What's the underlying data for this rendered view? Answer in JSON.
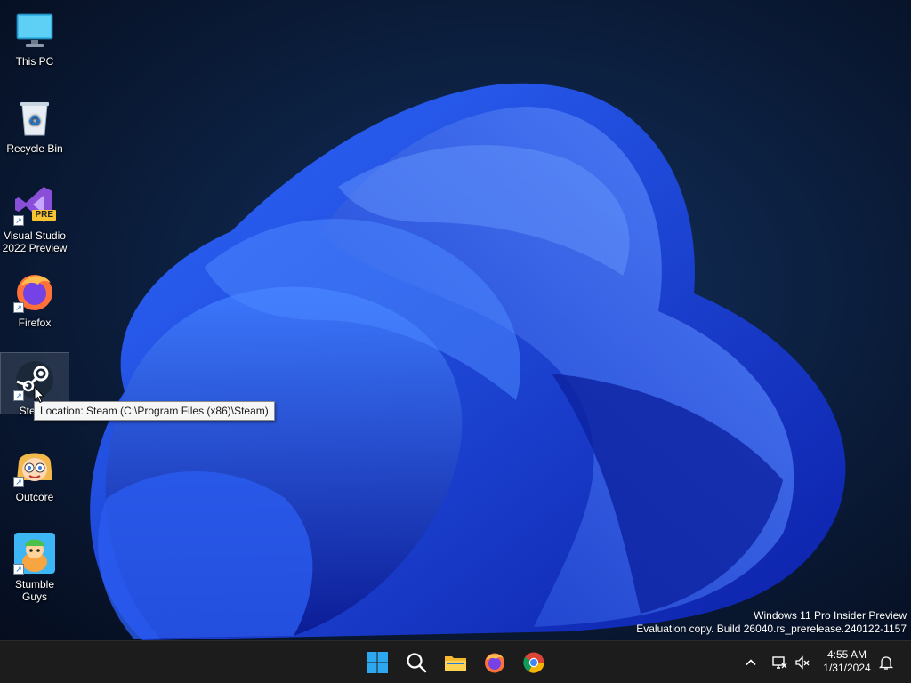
{
  "desktop": {
    "icons": [
      {
        "label": "This PC"
      },
      {
        "label": "Recycle Bin"
      },
      {
        "label": "Visual Studio 2022 Preview",
        "badge": "PRE"
      },
      {
        "label": "Firefox"
      },
      {
        "label": "Steam"
      },
      {
        "label": "Outcore"
      },
      {
        "label": "Stumble Guys"
      }
    ],
    "tooltip": "Location: Steam (C:\\Program Files (x86)\\Steam)"
  },
  "watermark": {
    "line1": "Windows 11 Pro Insider Preview",
    "line2": "Evaluation copy. Build 26040.rs_prerelease.240122-1157"
  },
  "taskbar": {
    "apps": [
      {
        "icon": "windows-start-icon"
      },
      {
        "icon": "search-icon"
      },
      {
        "icon": "file-explorer-icon"
      },
      {
        "icon": "firefox-icon"
      },
      {
        "icon": "chrome-icon"
      }
    ],
    "tray": [
      {
        "icon": "chevron-up-icon"
      },
      {
        "icon": "network-icon"
      },
      {
        "icon": "volume-muted-icon"
      },
      {
        "icon": "notification-bell-icon"
      }
    ],
    "clock": {
      "time": "4:55 AM",
      "date": "1/31/2024"
    }
  },
  "colors": {
    "wallpaper_dark": "#0a1730",
    "bloom_blue": "#1e4fe0",
    "taskbar": "#1c1c1c",
    "accent": "#2da8f0"
  }
}
